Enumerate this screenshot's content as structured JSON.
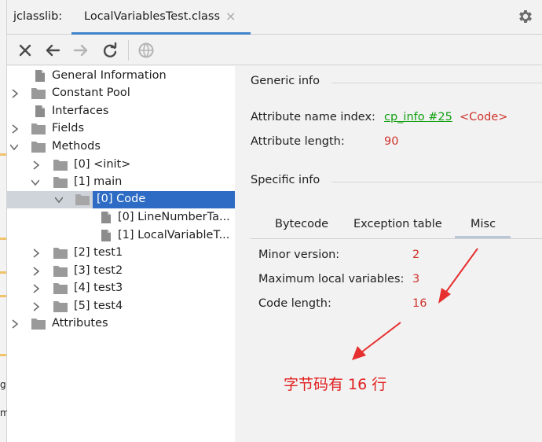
{
  "tabbar": {
    "plugin_label": "jclasslib:",
    "file_tab": "LocalVariablesTest.class",
    "close_glyph": "×"
  },
  "left_strip_text": [
    "g",
    "m"
  ],
  "tree": {
    "items": [
      {
        "label": "General Information"
      },
      {
        "label": "Constant Pool"
      },
      {
        "label": "Interfaces"
      },
      {
        "label": "Fields"
      },
      {
        "label": "Methods"
      },
      {
        "label": "[0] <init>"
      },
      {
        "label": "[1] main"
      },
      {
        "label": "[0] Code"
      },
      {
        "label": "[0] LineNumberTa..."
      },
      {
        "label": "[1] LocalVariableT..."
      },
      {
        "label": "[2] test1"
      },
      {
        "label": "[3] test2"
      },
      {
        "label": "[4] test3"
      },
      {
        "label": "[5] test4"
      },
      {
        "label": "Attributes"
      }
    ]
  },
  "detail": {
    "generic_title": "Generic info",
    "attr_name_key": "Attribute name index:",
    "attr_name_link": "cp_info #25",
    "attr_name_value": "<Code>",
    "attr_len_key": "Attribute length:",
    "attr_len_value": "90",
    "specific_title": "Specific info",
    "tabs": [
      "Bytecode",
      "Exception table",
      "Misc"
    ],
    "minor_key": "Minor version:",
    "minor_value": "2",
    "maxlocals_key": "Maximum local variables:",
    "maxlocals_value": "3",
    "codelen_key": "Code length:",
    "codelen_value": "16"
  },
  "annotation": {
    "text": "字节码有 16 行",
    "color": "#e02020"
  },
  "colors": {
    "selection": "#2e6bc4",
    "link": "#11a011",
    "value": "#d0342c",
    "tab_underline": "#4083c9"
  }
}
